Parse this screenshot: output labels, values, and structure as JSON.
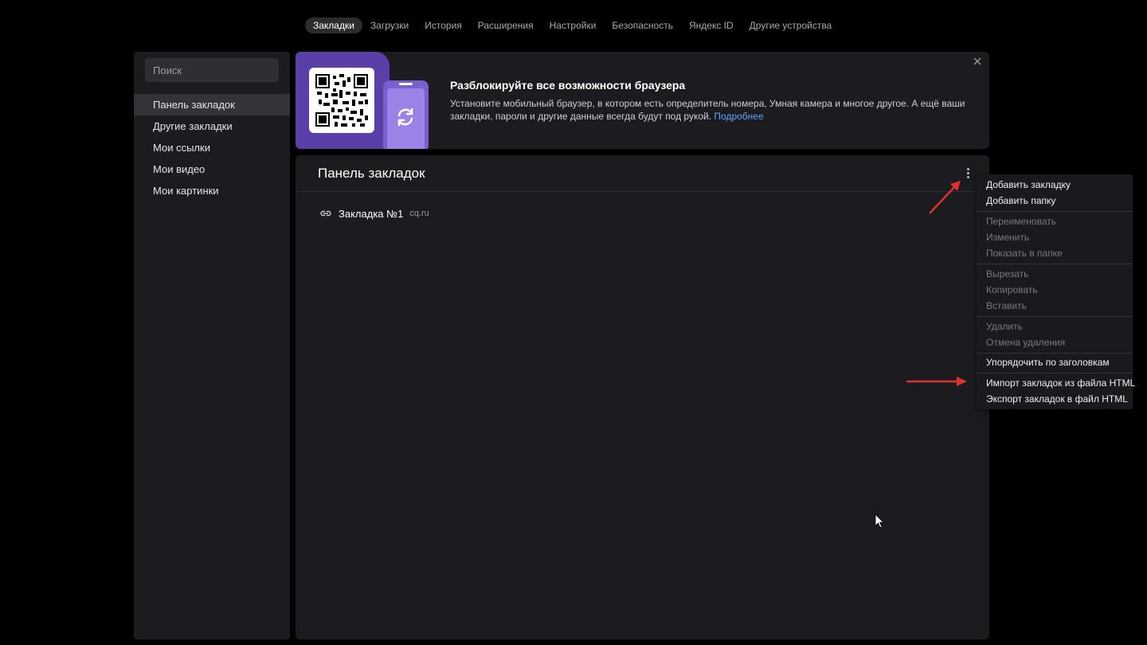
{
  "topnav": {
    "tabs": [
      {
        "label": "Закладки",
        "active": true
      },
      {
        "label": "Загрузки",
        "active": false
      },
      {
        "label": "История",
        "active": false
      },
      {
        "label": "Расширения",
        "active": false
      },
      {
        "label": "Настройки",
        "active": false
      },
      {
        "label": "Безопасность",
        "active": false
      },
      {
        "label": "Яндекс ID",
        "active": false
      },
      {
        "label": "Другие устройства",
        "active": false
      }
    ]
  },
  "sidebar": {
    "search_placeholder": "Поиск",
    "items": [
      {
        "label": "Панель закладок",
        "active": true
      },
      {
        "label": "Другие закладки",
        "active": false
      },
      {
        "label": "Мои ссылки",
        "active": false
      },
      {
        "label": "Мои видео",
        "active": false
      },
      {
        "label": "Мои картинки",
        "active": false
      }
    ]
  },
  "banner": {
    "title": "Разблокируйте все возможности браузера",
    "text": "Установите мобильный браузер, в котором есть определитель номера, Умная камера и многое другое. А ещё ваши закладки, пароли и другие данные всегда будут под рукой.",
    "link": "Подробнее",
    "close_icon": "close-icon"
  },
  "panel": {
    "title": "Панель закладок",
    "bookmarks": [
      {
        "title": "Закладка №1",
        "url": "cq.ru"
      }
    ]
  },
  "context_menu": {
    "items": [
      {
        "label": "Добавить закладку",
        "enabled": true
      },
      {
        "label": "Добавить папку",
        "enabled": true
      },
      {
        "label": "Переименовать",
        "enabled": false
      },
      {
        "label": "Изменить",
        "enabled": false
      },
      {
        "label": "Показать в папке",
        "enabled": false
      },
      {
        "label": "Вырезать",
        "enabled": false
      },
      {
        "label": "Копировать",
        "enabled": false
      },
      {
        "label": "Вставить",
        "enabled": false
      },
      {
        "label": "Удалить",
        "enabled": false
      },
      {
        "label": "Отмена удаления",
        "enabled": false
      },
      {
        "label": "Упорядочить по заголовкам",
        "enabled": true
      },
      {
        "label": "Импорт закладок из файла HTML",
        "enabled": true
      },
      {
        "label": "Экспорт закладок в файл HTML",
        "enabled": true
      }
    ]
  },
  "colors": {
    "background": "#000000",
    "panel": "#1c1c20",
    "accent_purple": "#5b3fa8",
    "link": "#5aa3ff",
    "annotation_arrow": "#e03030"
  }
}
